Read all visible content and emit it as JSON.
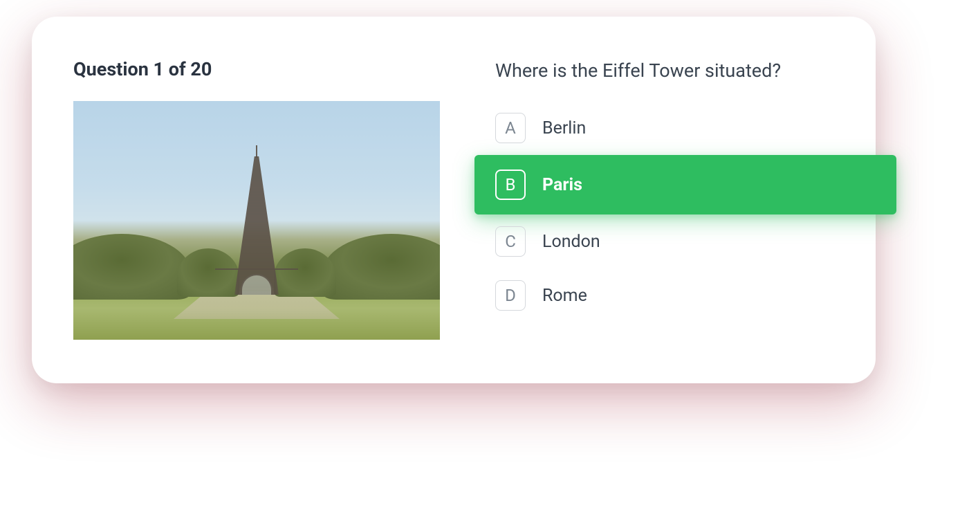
{
  "quiz": {
    "counter": "Question 1 of 20",
    "question": "Where is the Eiffel Tower situated?",
    "image_alt": "Eiffel Tower viewed from Champ de Mars",
    "options": [
      {
        "letter": "A",
        "label": "Berlin",
        "selected": false
      },
      {
        "letter": "B",
        "label": "Paris",
        "selected": true
      },
      {
        "letter": "C",
        "label": "London",
        "selected": false
      },
      {
        "letter": "D",
        "label": "Rome",
        "selected": false
      }
    ],
    "colors": {
      "selected_bg": "#2ebd60",
      "text_primary": "#2a3340"
    }
  }
}
